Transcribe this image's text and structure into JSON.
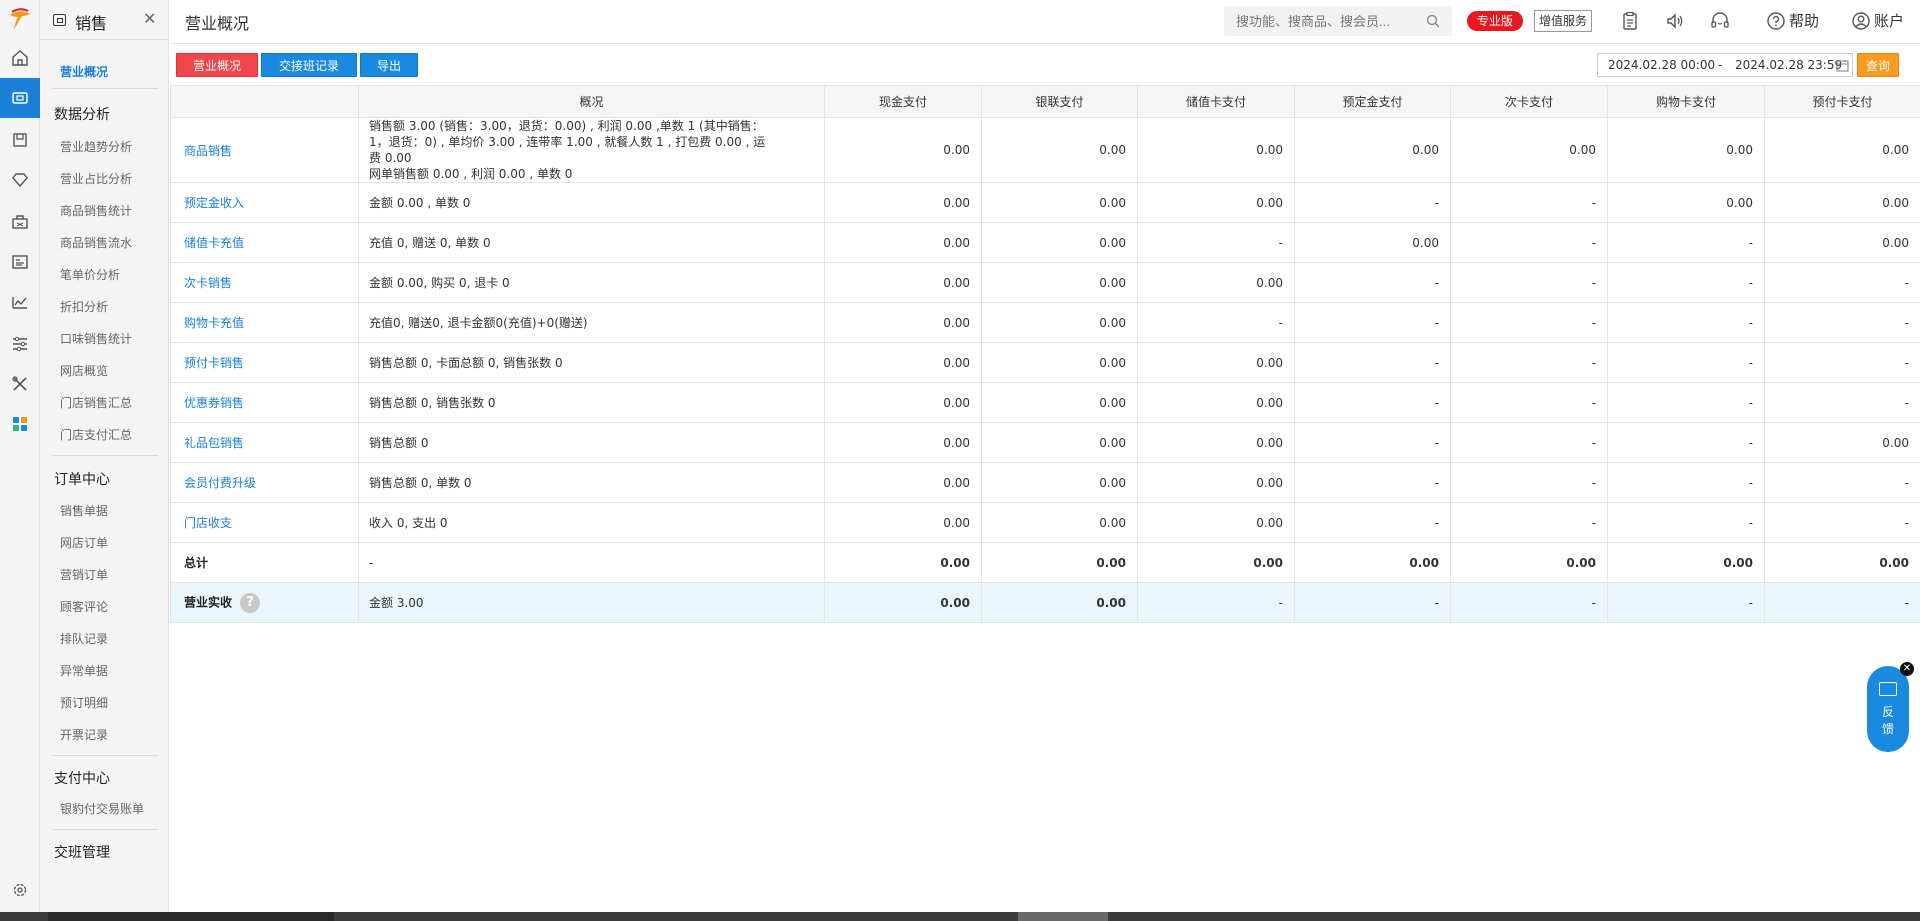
{
  "sidebar": {
    "module_title": "销售",
    "sections": [
      {
        "title": "",
        "items": [
          "营业概况"
        ]
      },
      {
        "title": "数据分析",
        "items": [
          "营业趋势分析",
          "营业占比分析",
          "商品销售统计",
          "商品销售流水",
          "笔单价分析",
          "折扣分析",
          "口味销售统计",
          "网店概览",
          "门店销售汇总",
          "门店支付汇总"
        ]
      },
      {
        "title": "订单中心",
        "items": [
          "销售单据",
          "网店订单",
          "营销订单",
          "顾客评论",
          "排队记录",
          "异常单据",
          "预订明细",
          "开票记录"
        ]
      },
      {
        "title": "支付中心",
        "items": [
          "银豹付交易账单"
        ]
      },
      {
        "title": "交班管理",
        "items": []
      }
    ]
  },
  "header": {
    "title": "营业概况",
    "search_placeholder": "搜功能、搜商品、搜会员...",
    "edition_badge": "专业版",
    "value_added": "增值服务",
    "help": "帮助",
    "account": "账户"
  },
  "toolbar": {
    "btn_overview": "营业概况",
    "btn_shift": "交接班记录",
    "btn_export": "导出",
    "date_start": "2024.02.28 00:00",
    "date_sep": "-",
    "date_end": "2024.02.28 23:59",
    "btn_query": "查询"
  },
  "table": {
    "columns": [
      "",
      "概况",
      "现金支付",
      "银联支付",
      "储值卡支付",
      "预定金支付",
      "次卡支付",
      "购物卡支付",
      "预付卡支付"
    ],
    "rows": [
      {
        "name": "商品销售",
        "desc": [
          "销售额 3.00 (销售：3.00，退货：0.00) , 利润 0.00 ,单数 1 (其中销售：",
          "1，退货：0) , 单均价 3.00 , 连带率 1.00 , 就餐人数 1 , 打包费 0.00 , 运",
          "费 0.00",
          "网单销售额 0.00 , 利润 0.00 , 单数 0"
        ],
        "values": [
          "0.00",
          "0.00",
          "0.00",
          "0.00",
          "0.00",
          "0.00",
          "0.00"
        ]
      },
      {
        "name": "预定金收入",
        "desc": [
          "金额 0.00 , 单数 0"
        ],
        "values": [
          "0.00",
          "0.00",
          "0.00",
          "-",
          "-",
          "0.00",
          "0.00"
        ]
      },
      {
        "name": "储值卡充值",
        "desc": [
          "充值 0, 赠送 0, 单数 0"
        ],
        "values": [
          "0.00",
          "0.00",
          "-",
          "0.00",
          "-",
          "-",
          "0.00"
        ]
      },
      {
        "name": "次卡销售",
        "desc": [
          "金额 0.00, 购买 0, 退卡 0"
        ],
        "values": [
          "0.00",
          "0.00",
          "0.00",
          "-",
          "-",
          "-",
          "-"
        ]
      },
      {
        "name": "购物卡充值",
        "desc": [
          "充值0, 赠送0, 退卡金额0(充值)+0(赠送)"
        ],
        "values": [
          "0.00",
          "0.00",
          "-",
          "-",
          "-",
          "-",
          "-"
        ]
      },
      {
        "name": "预付卡销售",
        "desc": [
          "销售总额 0, 卡面总额 0, 销售张数 0"
        ],
        "values": [
          "0.00",
          "0.00",
          "0.00",
          "-",
          "-",
          "-",
          "-"
        ]
      },
      {
        "name": "优惠券销售",
        "desc": [
          "销售总额 0, 销售张数 0"
        ],
        "values": [
          "0.00",
          "0.00",
          "0.00",
          "-",
          "-",
          "-",
          "-"
        ]
      },
      {
        "name": "礼品包销售",
        "desc": [
          "销售总额 0"
        ],
        "values": [
          "0.00",
          "0.00",
          "0.00",
          "-",
          "-",
          "-",
          "0.00"
        ]
      },
      {
        "name": "会员付费升级",
        "desc": [
          "销售总额 0, 单数 0"
        ],
        "values": [
          "0.00",
          "0.00",
          "0.00",
          "-",
          "-",
          "-",
          "-"
        ]
      },
      {
        "name": "门店收支",
        "desc": [
          "收入 0, 支出 0"
        ],
        "values": [
          "0.00",
          "0.00",
          "0.00",
          "-",
          "-",
          "-",
          "-"
        ]
      }
    ],
    "total": {
      "name": "总计",
      "desc": "-",
      "values": [
        "0.00",
        "0.00",
        "0.00",
        "0.00",
        "0.00",
        "0.00",
        "0.00"
      ]
    },
    "actual": {
      "name": "营业实收",
      "desc": "金额 3.00",
      "values": [
        "0.00",
        "0.00",
        "-",
        "-",
        "-",
        "-",
        "-"
      ]
    }
  },
  "feedback": {
    "label_1": "反",
    "label_2": "馈"
  },
  "colors": {
    "accent": "#1a8ae0",
    "danger": "#f4454d",
    "warning": "#fb9a1e",
    "highlight_row": "#e9f6fb"
  }
}
